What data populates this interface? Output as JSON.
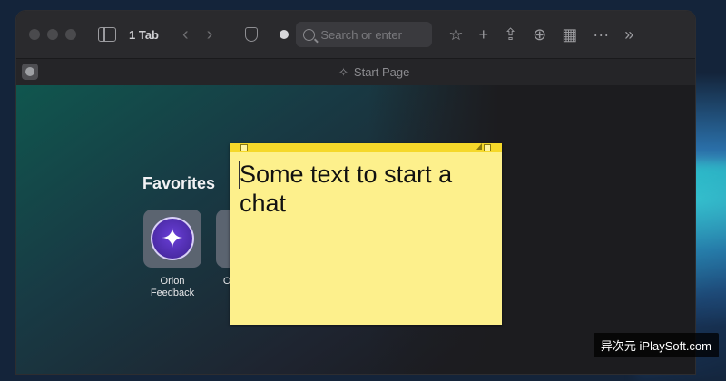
{
  "toolbar": {
    "tab_count": "1 Tab",
    "search_placeholder": "Search or enter",
    "icons": [
      "sidebar-icon",
      "back-icon",
      "forward-icon",
      "shield-icon",
      "star-icon",
      "plus-icon",
      "share-icon",
      "download-icon",
      "grid-icon",
      "more-icon",
      "chevrons-right-icon"
    ]
  },
  "tabbar": {
    "title": "Start Page"
  },
  "favorites": {
    "heading": "Favorites",
    "items": [
      {
        "label_line1": "Orion",
        "label_line2": "Feedback"
      },
      {
        "label_line1": "Or",
        "label_line2": ""
      }
    ]
  },
  "sticky": {
    "text": "Some text to start a chat",
    "color": "#fdf08c"
  },
  "watermark": {
    "text": "异次元 iPlaySoft.com"
  }
}
